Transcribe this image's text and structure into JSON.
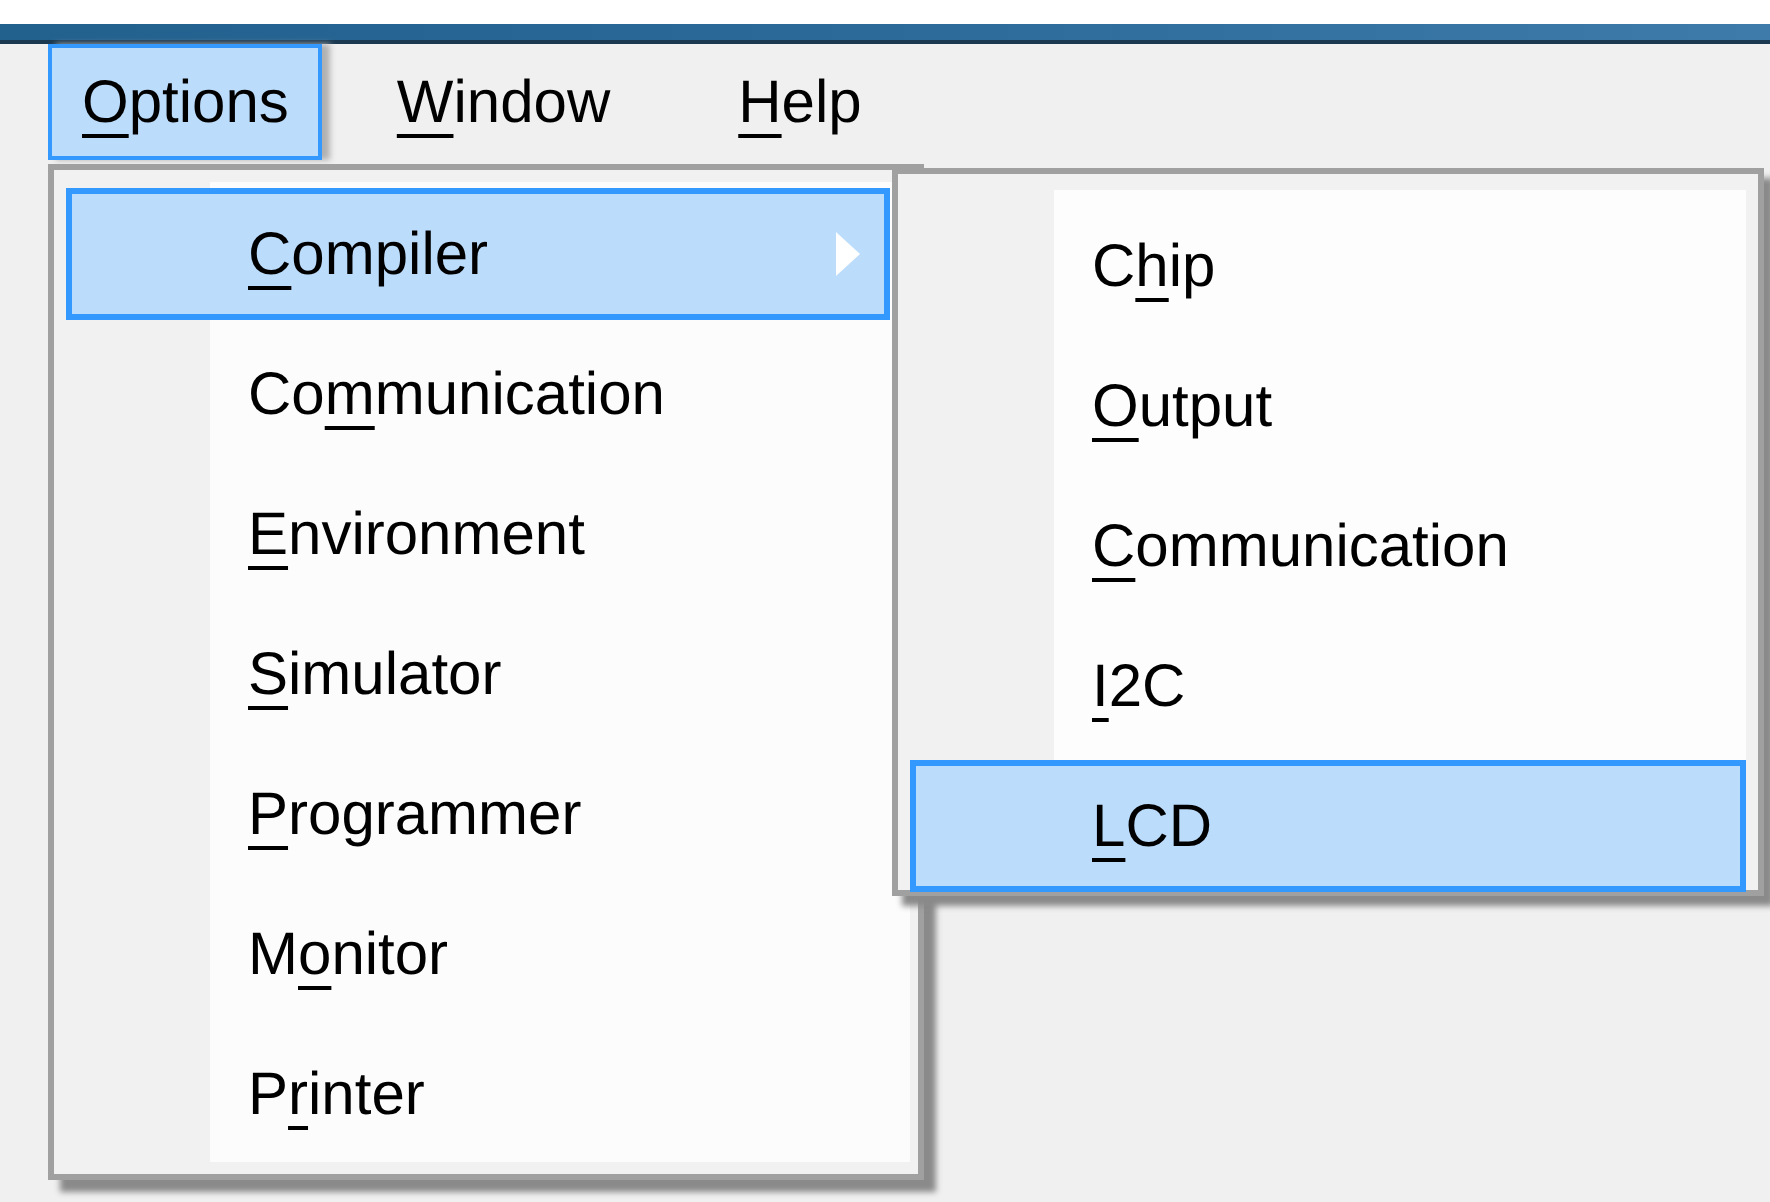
{
  "menu_bar": [
    {
      "key": "O",
      "rest": "ptions",
      "selected": true
    },
    {
      "key": "W",
      "rest": "indow",
      "selected": false
    },
    {
      "key": "H",
      "rest": "elp",
      "selected": false
    }
  ],
  "menu": {
    "items": [
      {
        "key": "C",
        "rest": "ompiler",
        "selected": true,
        "has_submenu": true
      },
      {
        "before": "Co",
        "key": "m",
        "rest": "munication",
        "selected": false,
        "has_submenu": false
      },
      {
        "key": "E",
        "rest": "nvironment",
        "selected": false,
        "has_submenu": false
      },
      {
        "key": "S",
        "rest": "imulator",
        "selected": false,
        "has_submenu": false
      },
      {
        "key": "P",
        "rest": "rogrammer",
        "selected": false,
        "has_submenu": false
      },
      {
        "before": "M",
        "key": "o",
        "rest": "nitor",
        "selected": false,
        "has_submenu": false
      },
      {
        "before": "P",
        "key": "r",
        "rest": "inter",
        "selected": false,
        "has_submenu": false
      }
    ]
  },
  "submenu": {
    "items": [
      {
        "before": "C",
        "key": "h",
        "rest": "ip",
        "selected": false
      },
      {
        "key": "O",
        "rest": "utput",
        "selected": false
      },
      {
        "key": "C",
        "rest": "ommunication",
        "selected": false
      },
      {
        "key": "I",
        "rest": "2C",
        "selected": false
      },
      {
        "key": "L",
        "rest": "CD",
        "selected": true
      }
    ]
  }
}
